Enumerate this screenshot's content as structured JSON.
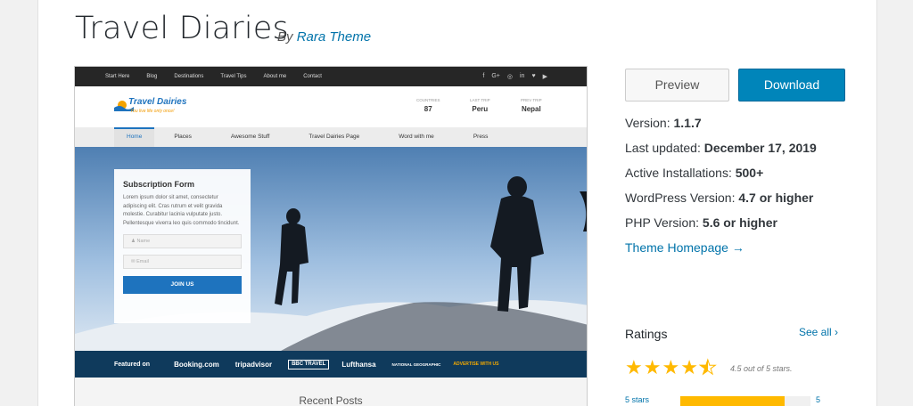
{
  "theme": {
    "title": "Travel Diaries",
    "by": "By",
    "author": "Rara Theme"
  },
  "preview_site": {
    "topnav": [
      "Start Here",
      "Blog",
      "Destinations",
      "Travel Tips",
      "About me",
      "Contact"
    ],
    "social": [
      "f",
      "G+",
      "◎",
      "in",
      "♥",
      "▶"
    ],
    "logo_name": "Travel Dairies",
    "logo_tagline": "You live life only once!",
    "stats": [
      {
        "label": "COUNTRIES",
        "value": "87"
      },
      {
        "label": "LAST TRIP",
        "value": "Peru"
      },
      {
        "label": "PREV TRIP",
        "value": "Nepal"
      }
    ],
    "nav": [
      "Home",
      "Places",
      "Awesome Stuff",
      "Travel Dairies Page",
      "Word with me",
      "Press"
    ],
    "form_title": "Subscription Form",
    "form_text": "Lorem ipsum dolor sit amet, consectetur adipiscing elit. Cras rutrum et velit gravida molestie. Curabitur lacinia vulputate justo. Pellentesque viverra leo quis commodo tincidunt.",
    "name_placeholder": "Name",
    "email_placeholder": "Email",
    "join_label": "JOIN US",
    "featured_on": "Featured on",
    "featured": [
      "Booking.com",
      "tripadvisor",
      "BBC TRAVEL",
      "Lufthansa",
      "NATIONAL GEOGRAPHIC",
      "ADVERTISE WITH US"
    ],
    "recent_posts": "Recent Posts"
  },
  "actions": {
    "preview": "Preview",
    "download": "Download"
  },
  "meta": {
    "version_label": "Version:",
    "version": "1.1.7",
    "updated_label": "Last updated:",
    "updated": "December 17, 2019",
    "installs_label": "Active Installations:",
    "installs": "500+",
    "wp_label": "WordPress Version:",
    "wp": "4.7 or higher",
    "php_label": "PHP Version:",
    "php": "5.6 or higher",
    "homepage": "Theme Homepage →"
  },
  "ratings": {
    "heading": "Ratings",
    "see_all": "See all ›",
    "score_text": "4.5 out of 5 stars.",
    "score": 4.5,
    "bar_label": "5 stars",
    "bar_count": "5",
    "bar_fraction": 0.8,
    "star_color": "#ffb900"
  },
  "colors": {
    "accent": "#0085ba",
    "link": "#0073aa"
  }
}
